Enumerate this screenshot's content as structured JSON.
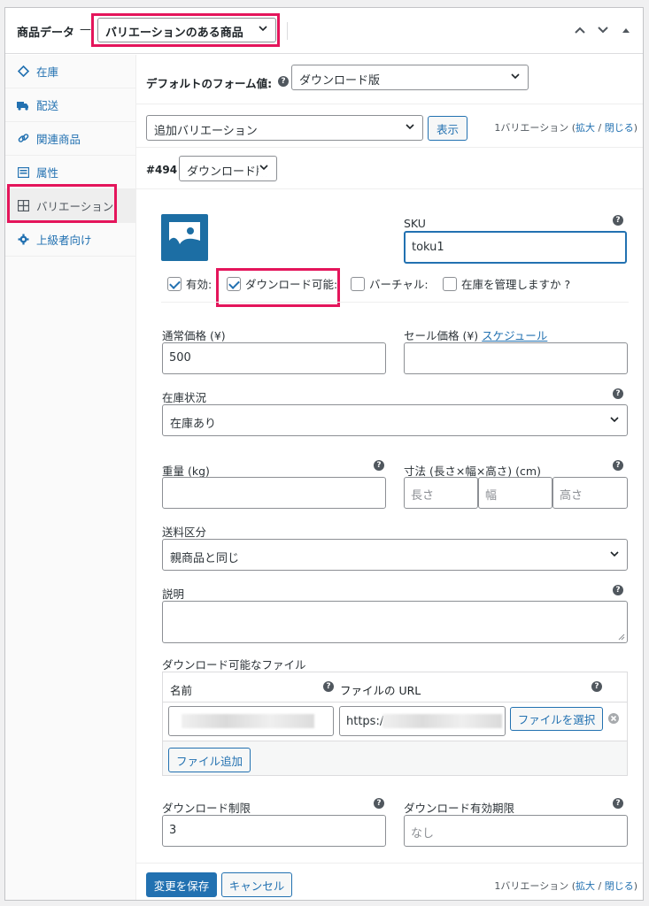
{
  "header": {
    "title": "商品データ",
    "dash": "—",
    "product_type": "バリエーションのある商品"
  },
  "tabs": [
    {
      "label": "在庫",
      "icon": "inventory-icon"
    },
    {
      "label": "配送",
      "icon": "truck-icon"
    },
    {
      "label": "関連商品",
      "icon": "link-icon"
    },
    {
      "label": "属性",
      "icon": "list-icon"
    },
    {
      "label": "バリエーション",
      "icon": "grid-icon"
    },
    {
      "label": "上級者向け",
      "icon": "gear-icon"
    }
  ],
  "defaults": {
    "label": "デフォルトのフォーム値:",
    "value": "ダウンロード版"
  },
  "add_variation": {
    "select": "追加バリエーション",
    "button": "表示",
    "count_text": "1バリエーション (",
    "expand": "拡大",
    "slash": " / ",
    "close": "閉じる",
    "close_paren": ")"
  },
  "variation": {
    "id": "#494",
    "attribute_value": "ダウンロード版",
    "sku_label": "SKU",
    "sku_value": "toku1",
    "enabled_label": "有効:",
    "downloadable_label": "ダウンロード可能:",
    "virtual_label": "バーチャル:",
    "manage_stock_label": "在庫を管理しますか ?",
    "regular_price_label": "通常価格 (¥)",
    "regular_price": "500",
    "sale_price_label": "セール価格 (¥)",
    "schedule_link": "スケジュール",
    "stock_status_label": "在庫状況",
    "stock_status": "在庫あり",
    "weight_label": "重量 (kg)",
    "dimensions_label": "寸法 (長さ×幅×高さ) (cm)",
    "length_ph": "長さ",
    "width_ph": "幅",
    "height_ph": "高さ",
    "shipping_class_label": "送料区分",
    "shipping_class": "親商品と同じ",
    "description_label": "説明",
    "downloads_label": "ダウンロード可能なファイル",
    "col_name": "名前",
    "col_url": "ファイルの URL",
    "file_url": "https://",
    "choose_file": "ファイルを選択",
    "add_file": "ファイル追加",
    "download_limit_label": "ダウンロード制限",
    "download_limit": "3",
    "download_expiry_label": "ダウンロード有効期限",
    "download_expiry_ph": "なし"
  },
  "footer": {
    "save": "変更を保存",
    "cancel": "キャンセル"
  },
  "colors": {
    "accent": "#2271b1",
    "highlight": "#e4155b"
  }
}
